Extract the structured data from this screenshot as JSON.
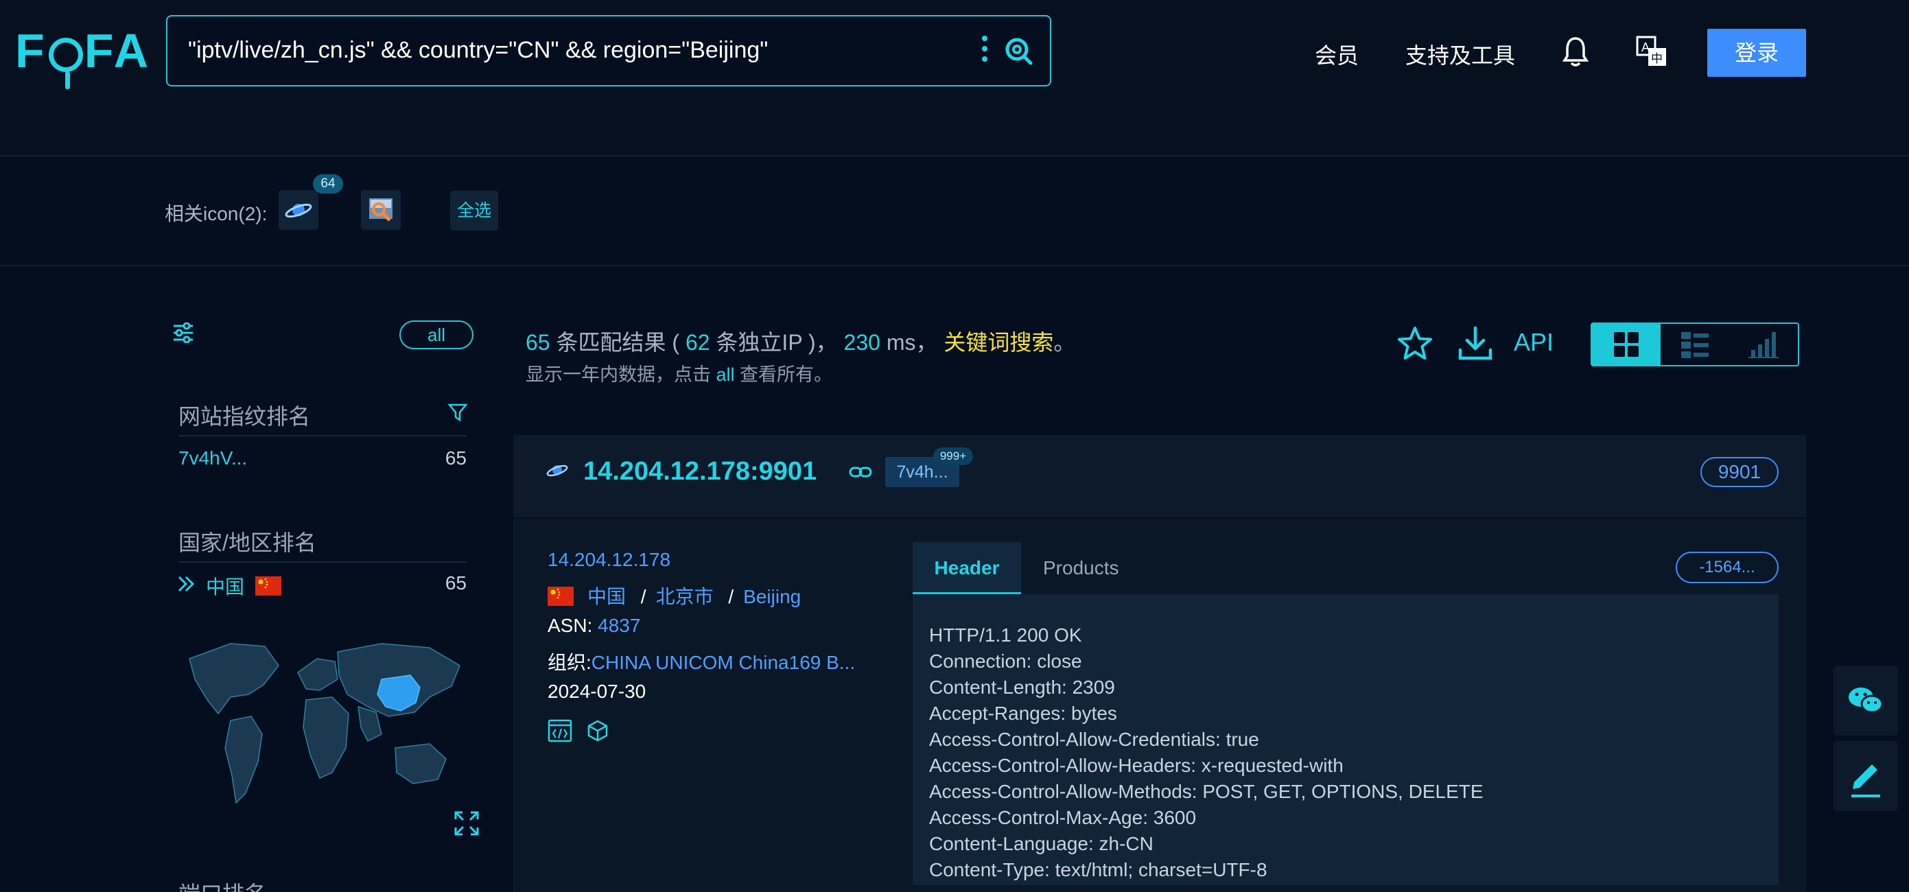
{
  "header": {
    "logo": {
      "f": "F",
      "rest": "FA"
    },
    "search_query": "\"iptv/live/zh_cn.js\" && country=\"CN\" && region=\"Beijing\"",
    "nav": {
      "member": "会员",
      "tools": "支持及工具"
    },
    "login_label": "登录"
  },
  "icon_filter": {
    "label": "相关icon(2):",
    "badge_count": "64",
    "select_all": "全选"
  },
  "sidebar": {
    "all_label": "all",
    "fingerprint_title": "网站指纹排名",
    "fingerprint_items": [
      {
        "name": "7v4hV...",
        "count": "65"
      }
    ],
    "country_title": "国家/地区排名",
    "country_items": [
      {
        "name": "中国",
        "count": "65"
      }
    ],
    "port_title": "端口排名"
  },
  "summary": {
    "count": "65",
    "text1": "条匹配结果 (",
    "unique_ip": "62",
    "text2": "条独立IP )，",
    "time": "230",
    "text3": "ms，",
    "keyword_search": "关键词搜索",
    "period": "。",
    "sub_prefix": "显示一年内数据，点击",
    "sub_all": "all",
    "sub_suffix": "查看所有。",
    "api_label": "API"
  },
  "result": {
    "ip_port": "14.204.12.178:9901",
    "tag": "7v4h...",
    "tag_badge": "999+",
    "port": "9901",
    "ip": "14.204.12.178",
    "country": "中国",
    "city": "北京市",
    "region": "Beijing",
    "sep": "/",
    "asn_label": "ASN:",
    "asn": "4837",
    "org_label": "组织:",
    "org": "CHINA UNICOM China169 B...",
    "date": "2024-07-30",
    "tab_header": "Header",
    "tab_products": "Products",
    "hash": "-1564...",
    "header_lines": [
      "HTTP/1.1 200 OK",
      "Connection: close",
      "Content-Length: 2309",
      "Accept-Ranges: bytes",
      "Access-Control-Allow-Credentials: true",
      "Access-Control-Allow-Headers: x-requested-with",
      "Access-Control-Allow-Methods: POST, GET, OPTIONS, DELETE",
      "Access-Control-Max-Age: 3600",
      "Content-Language: zh-CN",
      "Content-Type: text/html; charset=UTF-8"
    ]
  },
  "colors": {
    "accent": "#20d5e6",
    "primary": "#3d8dff",
    "highlight": "#f6e23a",
    "background": "#050e1e"
  }
}
